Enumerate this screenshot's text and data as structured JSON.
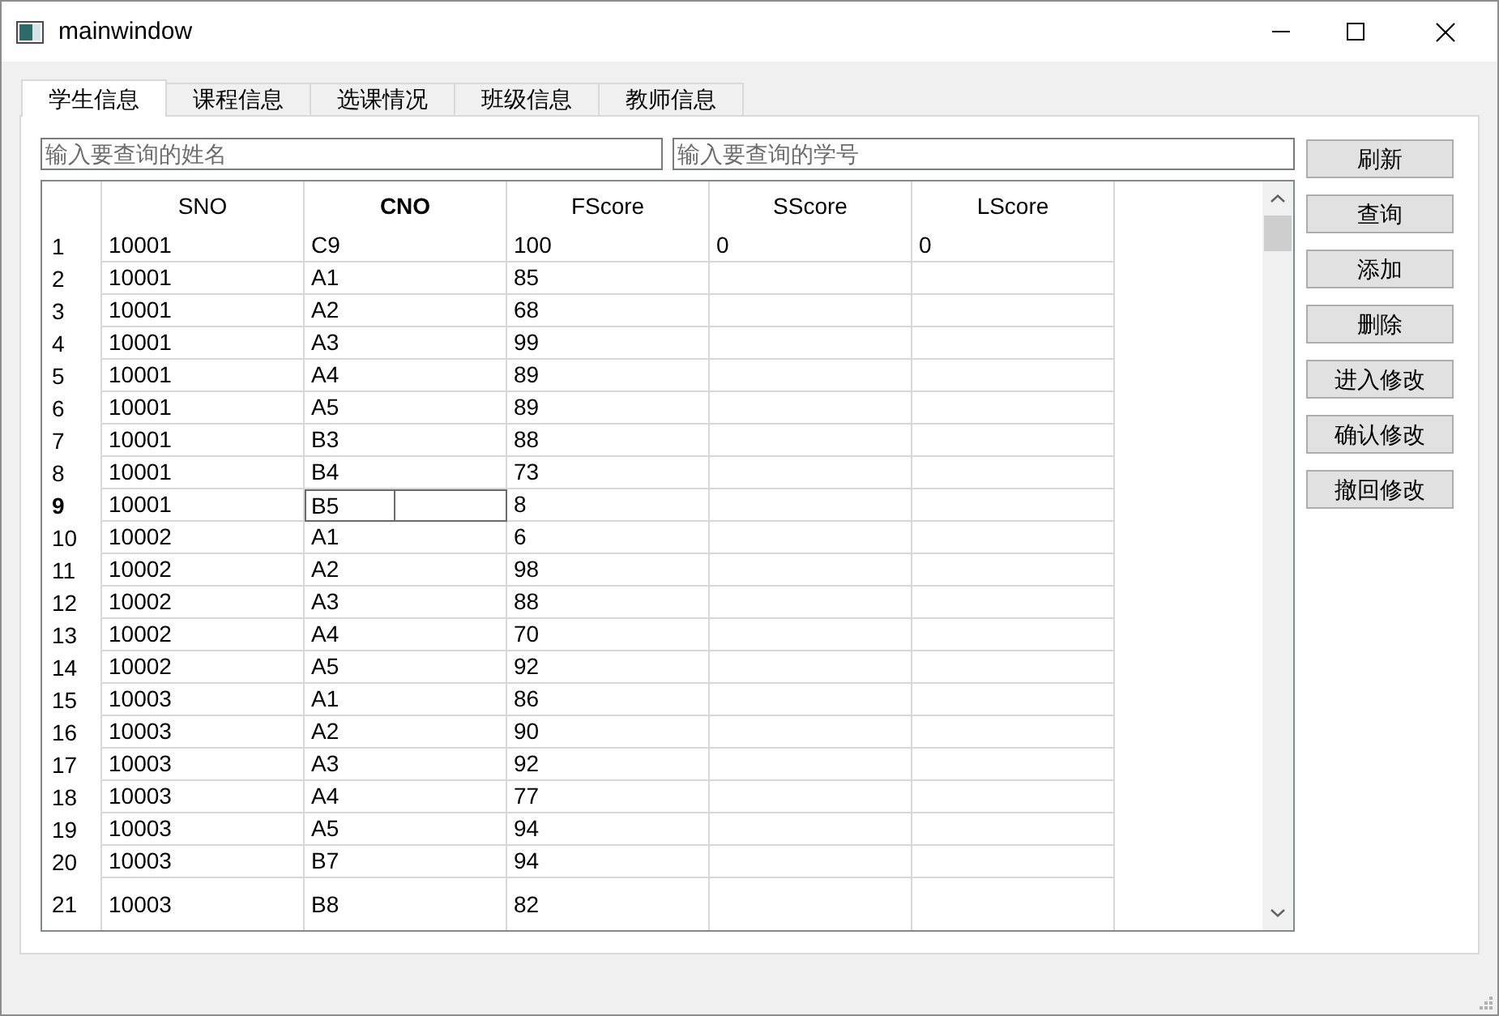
{
  "window": {
    "title": "mainwindow"
  },
  "tabs": [
    {
      "label": "学生信息",
      "selected": true
    },
    {
      "label": "课程信息",
      "selected": false
    },
    {
      "label": "选课情况",
      "selected": false
    },
    {
      "label": "班级信息",
      "selected": false
    },
    {
      "label": "教师信息",
      "selected": false
    }
  ],
  "search_fields": [
    {
      "placeholder": "输入要查询的姓名"
    },
    {
      "placeholder": "输入要查询的学号"
    }
  ],
  "table": {
    "columns": [
      {
        "label": "SNO",
        "selected": false
      },
      {
        "label": "CNO",
        "selected": true
      },
      {
        "label": "FScore",
        "selected": false
      },
      {
        "label": "SScore",
        "selected": false
      },
      {
        "label": "LScore",
        "selected": false
      }
    ],
    "rows": [
      {
        "header": "1",
        "selected": false,
        "cells": [
          "10001",
          "C9",
          "100",
          "0",
          "0"
        ]
      },
      {
        "header": "2",
        "selected": false,
        "cells": [
          "10001",
          "A1",
          "85"
        ]
      },
      {
        "header": "3",
        "selected": false,
        "cells": [
          "10001",
          "A2",
          "68"
        ]
      },
      {
        "header": "4",
        "selected": false,
        "cells": [
          "10001",
          "A3",
          "99"
        ]
      },
      {
        "header": "5",
        "selected": false,
        "cells": [
          "10001",
          "A4",
          "89"
        ]
      },
      {
        "header": "6",
        "selected": false,
        "cells": [
          "10001",
          "A5",
          "89"
        ]
      },
      {
        "header": "7",
        "selected": false,
        "cells": [
          "10001",
          "B3",
          "88"
        ]
      },
      {
        "header": "8",
        "selected": false,
        "cells": [
          "10001",
          "B4",
          "73"
        ]
      },
      {
        "header": "9",
        "selected": true,
        "cells": [
          "10001",
          "B5",
          "8"
        ]
      },
      {
        "header": "10",
        "selected": false,
        "cells": [
          "10002",
          "A1",
          "6"
        ]
      },
      {
        "header": "11",
        "selected": false,
        "cells": [
          "10002",
          "A2",
          "98"
        ]
      },
      {
        "header": "12",
        "selected": false,
        "cells": [
          "10002",
          "A3",
          "88"
        ]
      },
      {
        "header": "13",
        "selected": false,
        "cells": [
          "10002",
          "A4",
          "70"
        ]
      },
      {
        "header": "14",
        "selected": false,
        "cells": [
          "10002",
          "A5",
          "92"
        ]
      },
      {
        "header": "15",
        "selected": false,
        "cells": [
          "10003",
          "A1",
          "86"
        ]
      },
      {
        "header": "16",
        "selected": false,
        "cells": [
          "10003",
          "A2",
          "90"
        ]
      },
      {
        "header": "17",
        "selected": false,
        "cells": [
          "10003",
          "A3",
          "92"
        ]
      },
      {
        "header": "18",
        "selected": false,
        "cells": [
          "10003",
          "A4",
          "77"
        ]
      },
      {
        "header": "19",
        "selected": false,
        "cells": [
          "10003",
          "A5",
          "94"
        ]
      },
      {
        "header": "20",
        "selected": false,
        "cells": [
          "10003",
          "B7",
          "94"
        ]
      },
      {
        "header": "21",
        "selected": false,
        "cells": [
          "10003",
          "B8",
          "82"
        ]
      }
    ]
  },
  "buttons": [
    "刷新",
    "查询",
    "添加",
    "删除",
    "进入修改",
    "确认修改",
    "撤回修改"
  ]
}
